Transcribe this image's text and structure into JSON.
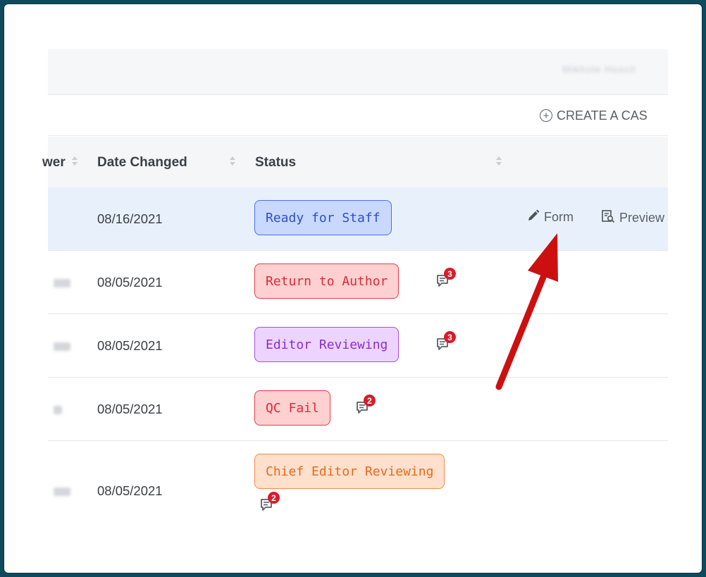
{
  "topbar": {
    "user_name": "Mikhole Hoscil"
  },
  "toolbar": {
    "create_label": "CREATE A CAS"
  },
  "table": {
    "columns": [
      {
        "label": "wer"
      },
      {
        "label": "Date Changed"
      },
      {
        "label": "Status"
      }
    ],
    "rows": [
      {
        "date": "08/16/2021",
        "status": "Ready for Staff",
        "status_color": "blue",
        "actions": {
          "form": "Form",
          "preview": "Preview"
        }
      },
      {
        "date": "08/05/2021",
        "status": "Return to Author",
        "status_color": "red",
        "comments": "3"
      },
      {
        "date": "08/05/2021",
        "status": "Editor Reviewing",
        "status_color": "purple",
        "comments": "3"
      },
      {
        "date": "08/05/2021",
        "status": "QC Fail",
        "status_color": "red",
        "comments": "2"
      },
      {
        "date": "08/05/2021",
        "status": "Chief Editor Reviewing",
        "status_color": "orange",
        "comments": "2"
      }
    ]
  },
  "annotation": {
    "arrow_color": "#cc1010"
  },
  "icons": [
    "plus-circle-icon",
    "sort-icon",
    "pencil-icon",
    "preview-icon",
    "comment-icon"
  ]
}
